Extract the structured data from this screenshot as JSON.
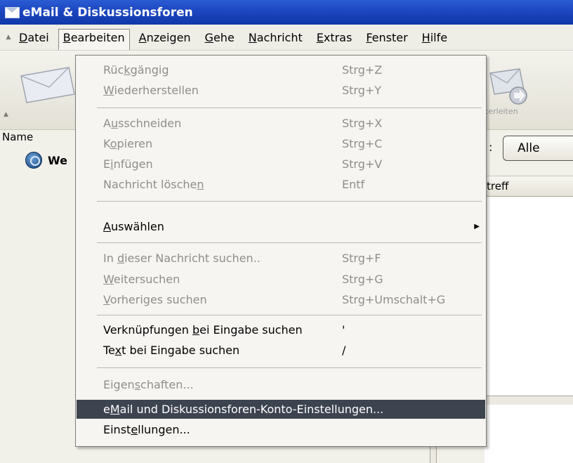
{
  "window": {
    "title": "eMail & Diskussionsforen"
  },
  "menubar": [
    {
      "pre": "",
      "u": "D",
      "post": "atei"
    },
    {
      "pre": "",
      "u": "B",
      "post": "earbeiten"
    },
    {
      "pre": "",
      "u": "A",
      "post": "nzeigen"
    },
    {
      "pre": "",
      "u": "G",
      "post": "ehe"
    },
    {
      "pre": "",
      "u": "N",
      "post": "achricht"
    },
    {
      "pre": "",
      "u": "E",
      "post": "xtras"
    },
    {
      "pre": "",
      "u": "F",
      "post": "enster"
    },
    {
      "pre": "",
      "u": "H",
      "post": "ilfe"
    }
  ],
  "toolbar": {
    "forward_label_partial": "iterleiten"
  },
  "left_pane": {
    "column_header": "Name",
    "account_name_partial": "We"
  },
  "filter": {
    "colon": ":",
    "value": "Alle"
  },
  "thread_pane": {
    "subject_header_partial": "treff"
  },
  "edit_menu": {
    "items": [
      {
        "pre": "Rüc",
        "u": "k",
        "post": "gängig",
        "acc": "Strg+Z",
        "enabled": false
      },
      {
        "pre": "",
        "u": "W",
        "post": "iederherstellen",
        "acc": "Strg+Y",
        "enabled": false
      },
      {
        "pre": "A",
        "u": "u",
        "post": "sschneiden",
        "acc": "Strg+X",
        "enabled": false
      },
      {
        "pre": "K",
        "u": "o",
        "post": "pieren",
        "acc": "Strg+C",
        "enabled": false
      },
      {
        "pre": "E",
        "u": "i",
        "post": "nfügen",
        "acc": "Strg+V",
        "enabled": false
      },
      {
        "pre": "Nachricht lösche",
        "u": "n",
        "post": "",
        "acc": "Entf",
        "enabled": false
      },
      {
        "pre": "",
        "u": "A",
        "post": "uswählen",
        "acc": "",
        "enabled": true
      },
      {
        "pre": "In ",
        "u": "d",
        "post": "ieser Nachricht suchen..",
        "acc": "Strg+F",
        "enabled": false
      },
      {
        "pre": "",
        "u": "W",
        "post": "eitersuchen",
        "acc": "Strg+G",
        "enabled": false
      },
      {
        "pre": "",
        "u": "V",
        "post": "orheriges suchen",
        "acc": "Strg+Umschalt+G",
        "enabled": false
      },
      {
        "pre": "Verknüpfungen ",
        "u": "b",
        "post": "ei Eingabe suchen",
        "acc": "'",
        "enabled": true
      },
      {
        "pre": "Te",
        "u": "x",
        "post": "t bei Eingabe suchen",
        "acc": "/",
        "enabled": true
      },
      {
        "pre": "Eigen",
        "u": "s",
        "post": "chaften...",
        "acc": "",
        "enabled": false
      },
      {
        "pre": "e",
        "u": "M",
        "post": "ail und Diskussionsforen-Konto-Einstellungen...",
        "acc": "",
        "enabled": true
      },
      {
        "pre": "Einst",
        "u": "e",
        "post": "llungen...",
        "acc": "",
        "enabled": true
      }
    ]
  },
  "colors": {
    "titlebar": "#1c46c0",
    "highlight": "#3d4450",
    "disabled_text": "#8f8e89"
  }
}
